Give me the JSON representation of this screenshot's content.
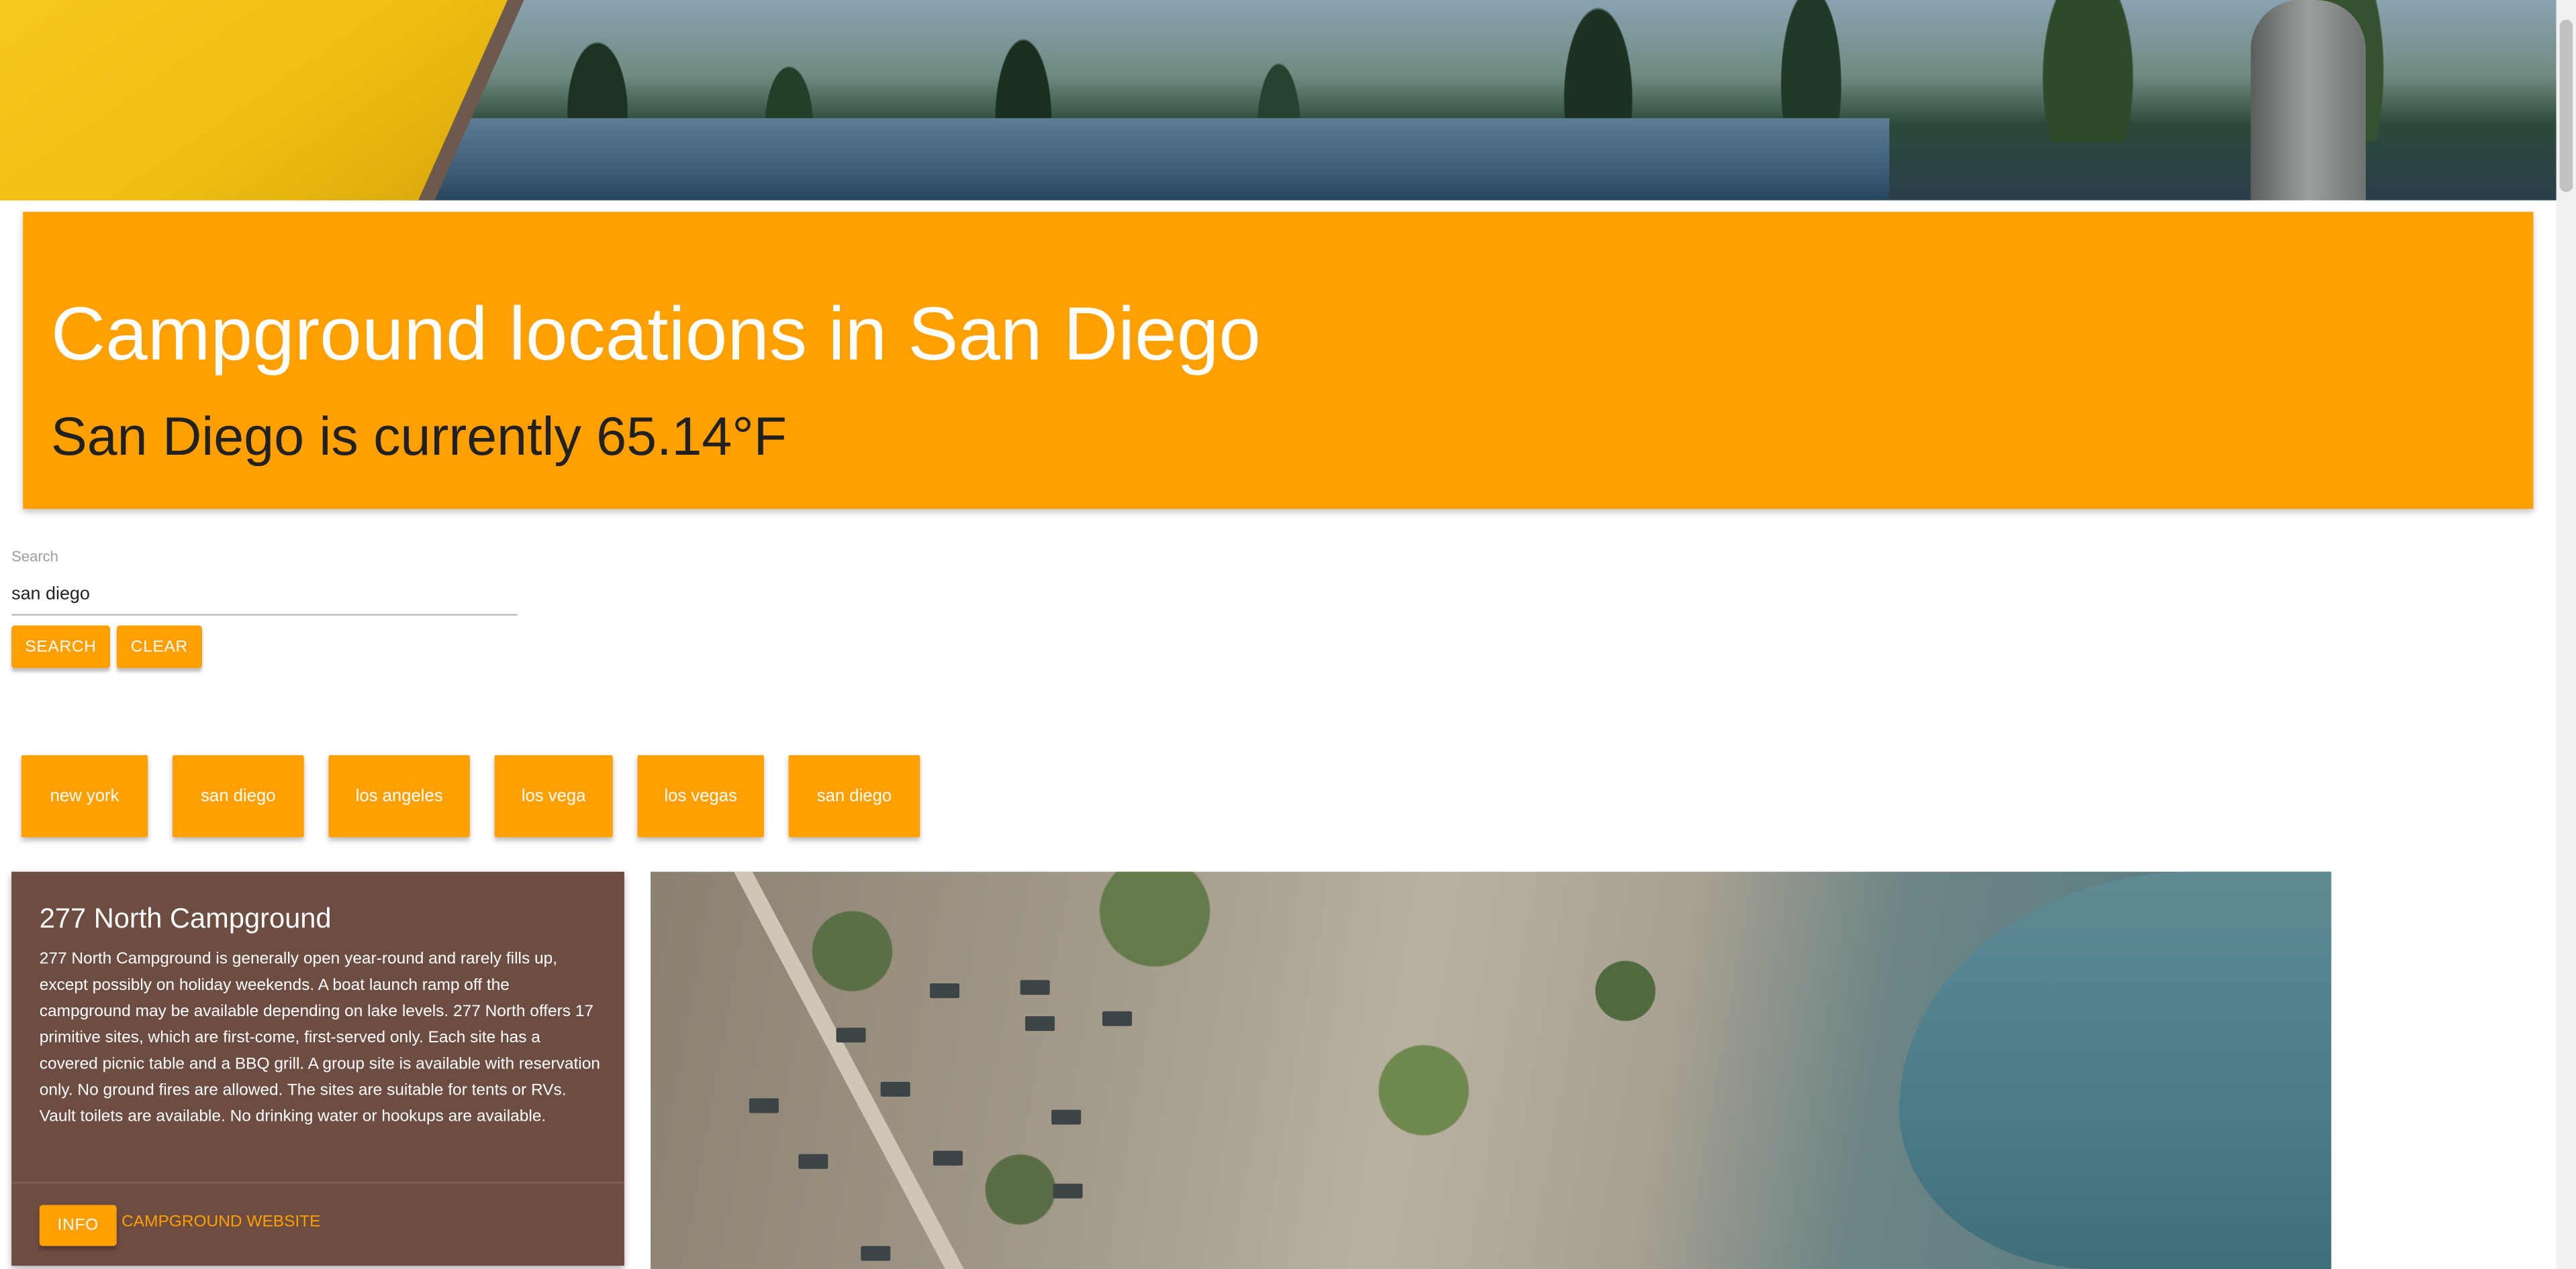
{
  "header": {
    "title": "Campground locations in San Diego",
    "weather": "San Diego is currently 65.14°F"
  },
  "search": {
    "label": "Search",
    "value": "san diego",
    "search_button": "SEARCH",
    "clear_button": "CLEAR"
  },
  "recent_searches": [
    "new york",
    "san diego",
    "los angeles",
    "los vega",
    "los vegas",
    "san diego"
  ],
  "campground": {
    "name": "277 North Campground",
    "description": "277 North Campground is generally open year-round and rarely fills up, except possibly on holiday weekends. A boat launch ramp off the campground may be available depending on lake levels. 277 North offers 17 primitive sites, which are first-come, first-served only. Each site has a covered picnic table and a BBQ grill. A group site is available with reservation only. No ground fires are allowed. The sites are suitable for tents or RVs. Vault toilets are available. No drinking water or hookups are available.",
    "info_button": "INFO",
    "website_link": "CAMPGROUND WEBSITE"
  },
  "colors": {
    "accent": "#ff9f00",
    "card_background": "#6d4c41"
  }
}
